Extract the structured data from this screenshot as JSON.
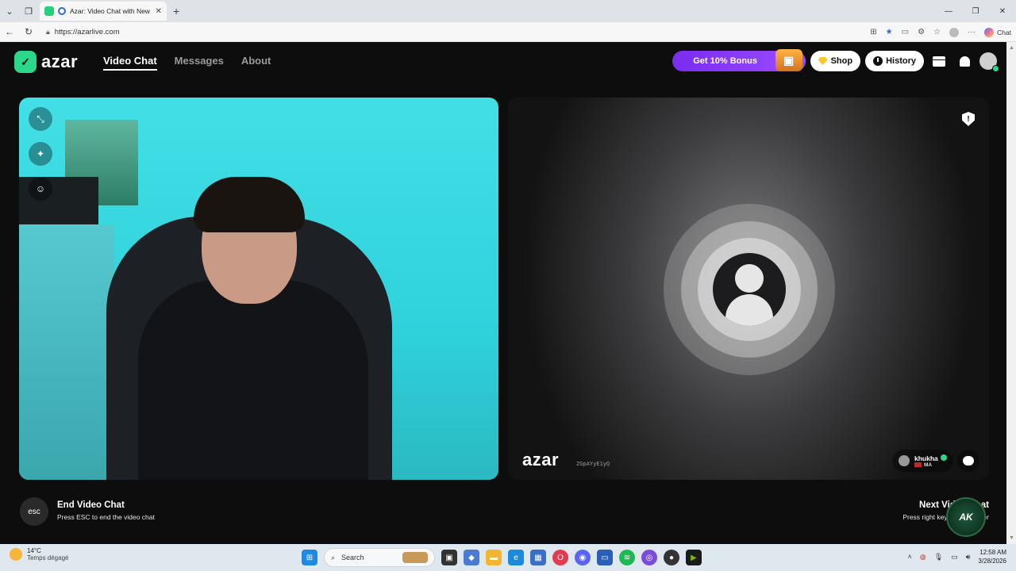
{
  "browser": {
    "tab_title": "Azar: Video Chat with New Pe",
    "url": "https://azarlive.com",
    "copilot_label": "Chat"
  },
  "app": {
    "logo": "azar",
    "nav": [
      {
        "label": "Video Chat",
        "active": true
      },
      {
        "label": "Messages",
        "active": false
      },
      {
        "label": "About",
        "active": false
      }
    ],
    "bonus_label": "Get 10% Bonus",
    "shop_label": "Shop",
    "history_label": "History"
  },
  "remote": {
    "watermark": "azar",
    "watermark_id": "ZGpAYyE1yQ",
    "peer_name": "khukha",
    "peer_country": "MA"
  },
  "hints": {
    "esc_key": "esc",
    "end_title": "End Video Chat",
    "end_sub": "Press ESC to end the video chat",
    "next_title": "Next Video Chat",
    "next_sub": "Press right key to meet other"
  },
  "badge": "AK",
  "taskbar": {
    "temp": "14°C",
    "weather": "Temps dégagé",
    "search_placeholder": "Search",
    "time": "12:58 AM",
    "date": "3/28/2026"
  },
  "colors": {
    "accent": "#2bd88a",
    "bonus": "#8a3cf7",
    "background": "#0d0d0d"
  }
}
